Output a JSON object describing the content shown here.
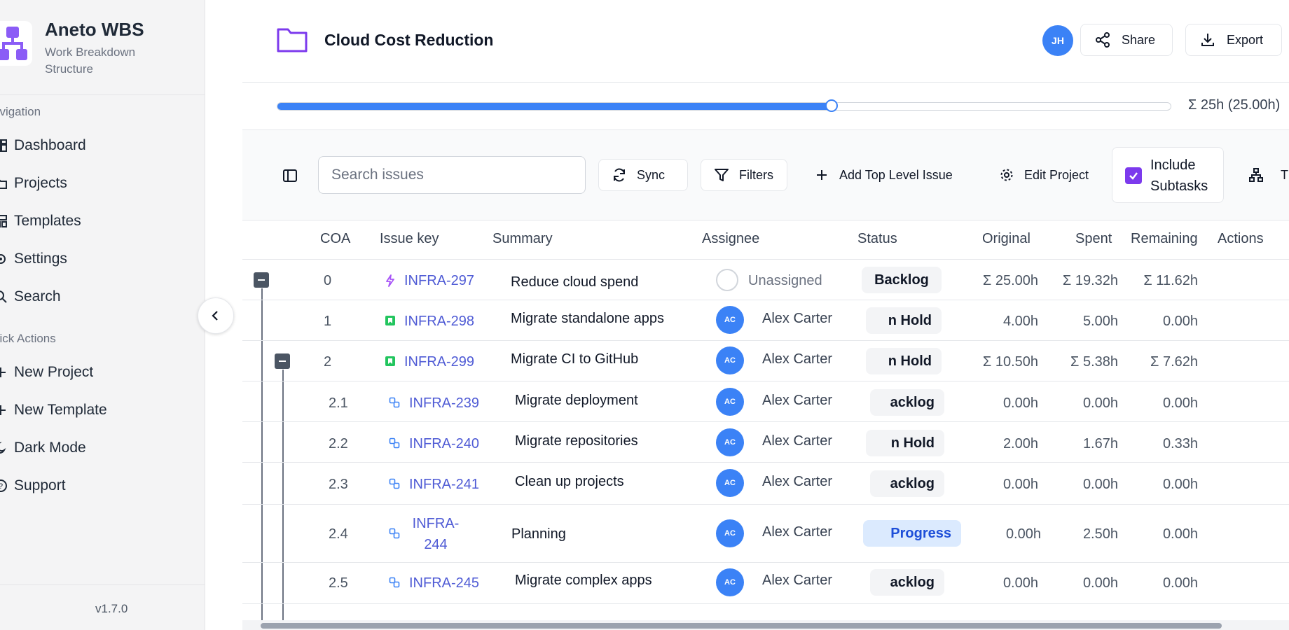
{
  "app": {
    "title": "Aneto WBS",
    "subtitle": "Work Breakdown Structure",
    "version": "v1.7.0"
  },
  "sidebar": {
    "nav_label": "avigation",
    "nav_items": [
      {
        "label": "Dashboard",
        "icon": "dashboard-icon"
      },
      {
        "label": "Projects",
        "icon": "folder-icon"
      },
      {
        "label": "Templates",
        "icon": "templates-icon"
      },
      {
        "label": "Settings",
        "icon": "settings-icon"
      },
      {
        "label": "Search",
        "icon": "search-icon"
      }
    ],
    "quick_label": "uick Actions",
    "quick_items": [
      {
        "label": "New Project",
        "icon": "plus-icon"
      },
      {
        "label": "New Template",
        "icon": "plus-icon"
      },
      {
        "label": "Dark Mode",
        "icon": "moon-icon"
      },
      {
        "label": "Support",
        "icon": "help-icon"
      }
    ]
  },
  "header": {
    "project_title": "Cloud Cost Reduction",
    "avatar_initials": "JH",
    "share_label": "Share",
    "export_label": "Export"
  },
  "progress": {
    "fraction": 0.62,
    "label": "Σ 25h (25.00h)"
  },
  "toolbar": {
    "search_placeholder": "Search issues",
    "sync_label": "Sync",
    "filters_label": "Filters",
    "add_label": "Add Top Level Issue",
    "edit_label": "Edit Project",
    "include_line1": "Include",
    "include_line2": "Subtasks",
    "include_checked": true,
    "tree_label": "T"
  },
  "table": {
    "columns": {
      "coa": "COA",
      "key": "Issue key",
      "summary": "Summary",
      "assignee": "Assignee",
      "status": "Status",
      "original": "Original",
      "spent": "Spent",
      "remaining": "Remaining",
      "actions": "Actions"
    },
    "rows": [
      {
        "coa": "0",
        "key": "INFRA-297",
        "summary": "Reduce cloud spend",
        "assignee": "Unassigned",
        "initials": "",
        "status": "Backlog",
        "original": "Σ 25.00h",
        "spent": "Σ 19.32h",
        "remaining": "Σ 11.62h"
      },
      {
        "coa": "1",
        "key": "INFRA-298",
        "summary": "Migrate standalone apps",
        "assignee": "Alex Carter",
        "initials": "AC",
        "status": "n Hold",
        "original": "4.00h",
        "spent": "5.00h",
        "remaining": "0.00h"
      },
      {
        "coa": "2",
        "key": "INFRA-299",
        "summary": "Migrate CI to GitHub",
        "assignee": "Alex Carter",
        "initials": "AC",
        "status": "n Hold",
        "original": "Σ 10.50h",
        "spent": "Σ 5.38h",
        "remaining": "Σ 7.62h"
      },
      {
        "coa": "2.1",
        "key": "INFRA-239",
        "summary": "Migrate deployment",
        "assignee": "Alex Carter",
        "initials": "AC",
        "status": "acklog",
        "original": "0.00h",
        "spent": "0.00h",
        "remaining": "0.00h"
      },
      {
        "coa": "2.2",
        "key": "INFRA-240",
        "summary": "Migrate repositories",
        "assignee": "Alex Carter",
        "initials": "AC",
        "status": "n Hold",
        "original": "2.00h",
        "spent": "1.67h",
        "remaining": "0.33h"
      },
      {
        "coa": "2.3",
        "key": "INFRA-241",
        "summary": "Clean up projects",
        "assignee": "Alex Carter",
        "initials": "AC",
        "status": "acklog",
        "original": "0.00h",
        "spent": "0.00h",
        "remaining": "0.00h"
      },
      {
        "coa": "2.4",
        "key": "INFRA-244",
        "key_line1": "INFRA-",
        "key_line2": "244",
        "summary": "Planning",
        "assignee": "Alex Carter",
        "initials": "AC",
        "status": "Progress",
        "original": "0.00h",
        "spent": "2.50h",
        "remaining": "0.00h"
      },
      {
        "coa": "2.5",
        "key": "INFRA-245",
        "summary": "Migrate complex apps",
        "assignee": "Alex Carter",
        "initials": "AC",
        "status": "acklog",
        "original": "0.00h",
        "spent": "0.00h",
        "remaining": "0.00h"
      }
    ]
  },
  "colors": {
    "accent": "#7c3aed",
    "primary": "#3b82f6",
    "link": "#4f5bd5"
  }
}
